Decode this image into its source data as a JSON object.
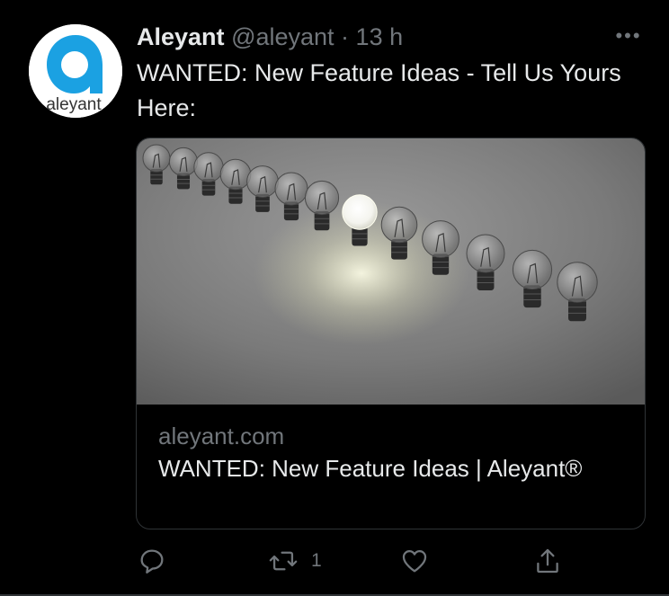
{
  "tweet": {
    "display_name": "Aleyant",
    "handle": "@aleyant",
    "separator": " · ",
    "time": "13 h",
    "text": "WANTED: New Feature Ideas - Tell Us Yours Here:",
    "more_icon": "more-horizontal-icon"
  },
  "avatar": {
    "logo_text": "aleyant",
    "brand_color": "#1ba1e2"
  },
  "card": {
    "domain": "aleyant.com",
    "title": "WANTED: New Feature Ideas | Aleyant®",
    "image_description_icon": "lightbulbs-image"
  },
  "actions": {
    "reply": {
      "icon": "reply-icon",
      "count": ""
    },
    "retweet": {
      "icon": "retweet-icon",
      "count": "1"
    },
    "like": {
      "icon": "heart-icon",
      "count": ""
    },
    "share": {
      "icon": "share-icon",
      "count": ""
    }
  },
  "colors": {
    "background": "#000000",
    "text_primary": "#e7e9ea",
    "text_secondary": "#71767b",
    "border": "#2f3336"
  }
}
